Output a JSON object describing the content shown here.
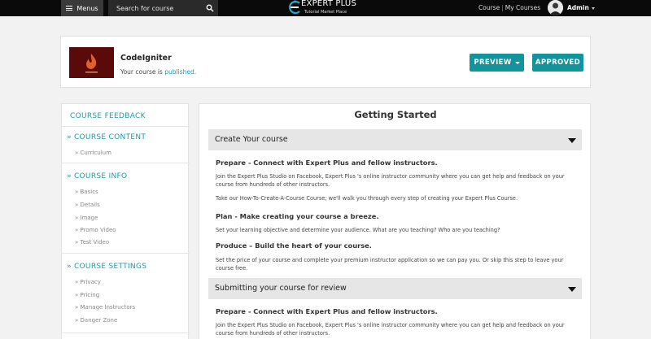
{
  "topbar": {
    "menus_label": "Menus",
    "search_placeholder": "Search for course",
    "logo_title": "EXPERT PLUS",
    "logo_subtitle": "Tutorial Market Place",
    "link_course": "Course",
    "link_my_courses": "My Courses",
    "user_name": "Admin"
  },
  "course": {
    "name": "CodeIgniter",
    "status_prefix": "Your course is ",
    "status_value": "published.",
    "preview_label": "PREVIEW",
    "approved_label": "APPROVED"
  },
  "sidebar": {
    "feedback": "COURSE FEEDBACK",
    "sections": [
      {
        "title": "» COURSE CONTENT",
        "items": [
          "» Curriculum"
        ]
      },
      {
        "title": "» COURSE INFO",
        "items": [
          "» Basics",
          "» Details",
          "» Image",
          "» Promo Video",
          "» Test Video"
        ]
      },
      {
        "title": "» COURSE SETTINGS",
        "items": [
          "» Privacy",
          "» Pricing",
          "» Manage Instructors",
          "» Danger Zone"
        ]
      }
    ]
  },
  "main": {
    "title": "Getting Started",
    "accordions": [
      {
        "title": "Create Your course",
        "blocks": [
          {
            "heading": "Prepare - Connect with Expert Plus and fellow instructors.",
            "paragraphs": [
              "Join the Expert Plus Studio on Facebook, Expert Plus 's online instructor community where you can get help and feedback on your course from hundreds of other instructors.",
              "Take our How-To-Create-A-Course Course; we'll walk you through every step of creating your Expert Plus Course."
            ]
          },
          {
            "heading": "Plan - Make creating your course a breeze.",
            "paragraphs": [
              "Set your learning objective and determine your audience. What are you teaching? Who are you teaching?"
            ]
          },
          {
            "heading": "Produce – Build the heart of your course.",
            "paragraphs": [
              "Set the price of your course and complete your premium instructor application so we can pay you. Or skip this step to leave your course free."
            ]
          }
        ]
      },
      {
        "title": "Submitting your course for review",
        "blocks": [
          {
            "heading": "Prepare - Connect with Expert Plus and fellow instructors.",
            "paragraphs": [
              "Join the Expert Plus Studio on Facebook, Expert Plus 's online instructor community where you can get help and feedback on your course from hundreds of other instructors."
            ]
          }
        ]
      }
    ]
  },
  "colors": {
    "accent": "#13939c",
    "link": "#1e9aa7",
    "topbar": "#0a0a0a"
  }
}
